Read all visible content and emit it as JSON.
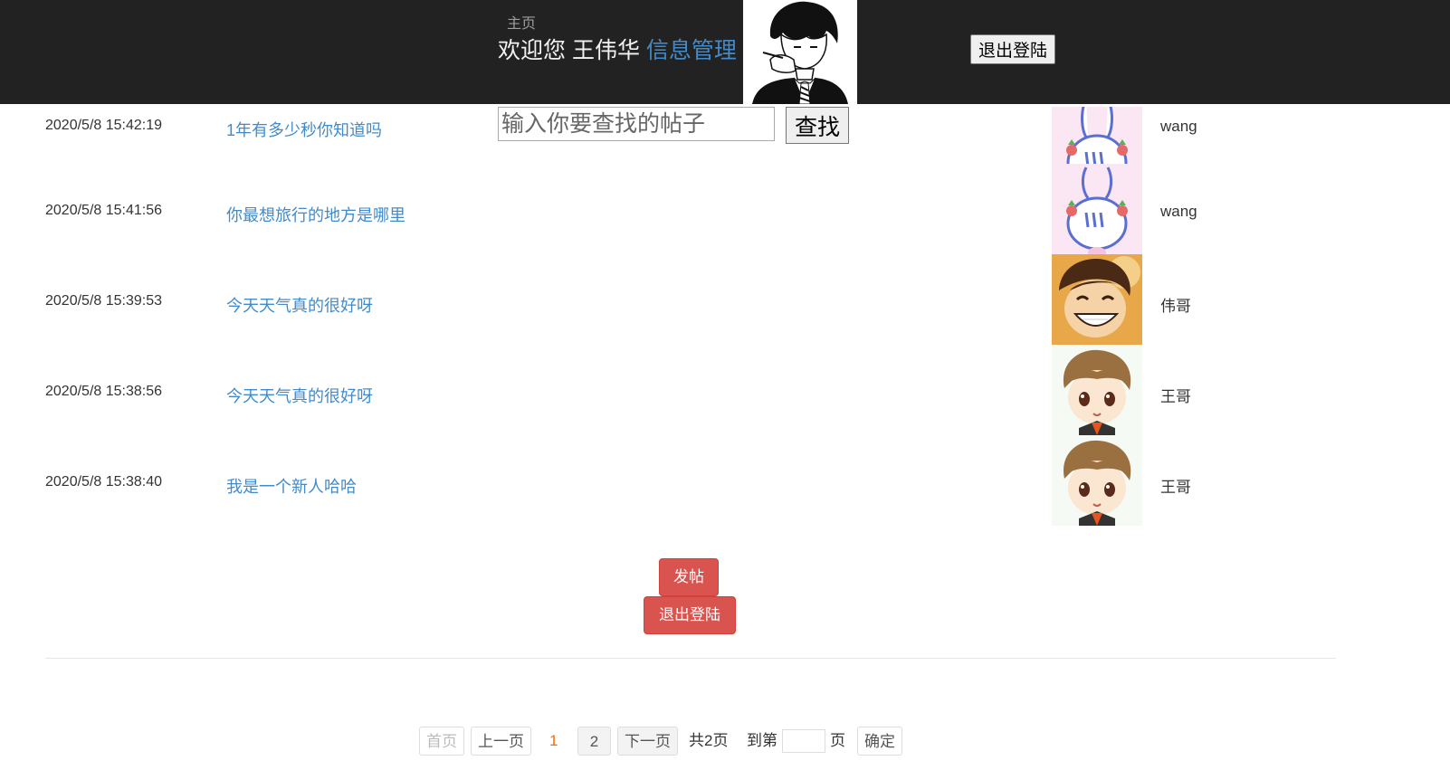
{
  "header": {
    "home_label": "主页",
    "welcome_prefix": "欢迎您 王伟华",
    "manage_label": "信息管理",
    "logout_label": "退出登陆",
    "background": "#222222",
    "link_color": "#428bca"
  },
  "search": {
    "placeholder": "输入你要查找的帖子",
    "button_label": "查找"
  },
  "posts": [
    {
      "time": "2020/5/8 15:42:19",
      "title": "1年有多少秒你知道吗",
      "author": "wang",
      "avatar": "bunny-avatar"
    },
    {
      "time": "2020/5/8 15:41:56",
      "title": "你最想旅行的地方是哪里",
      "author": "wang",
      "avatar": "bunny-avatar"
    },
    {
      "time": "2020/5/8 15:39:53",
      "title": "今天天气真的很好呀",
      "author": "伟哥",
      "avatar": "smiling-boy-avatar"
    },
    {
      "time": "2020/5/8 15:38:56",
      "title": "今天天气真的很好呀",
      "author": "王哥",
      "avatar": "chibi-boy-avatar"
    },
    {
      "time": "2020/5/8 15:38:40",
      "title": "我是一个新人哈哈",
      "author": "王哥",
      "avatar": "chibi-boy-avatar"
    }
  ],
  "actions": {
    "post_label": "发帖",
    "logout_label": "退出登陆",
    "color": "#d9534f"
  },
  "pagination": {
    "first": "首页",
    "prev": "上一页",
    "current": "1",
    "page2": "2",
    "next": "下一页",
    "total": "共2页",
    "goto_prefix": "到第",
    "goto_suffix": "页",
    "confirm": "确定",
    "current_color": "#ff6a00"
  }
}
